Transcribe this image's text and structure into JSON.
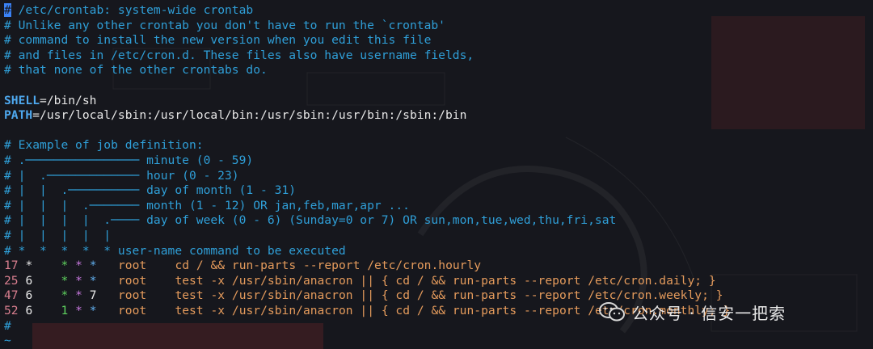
{
  "header_comments": [
    "# /etc/crontab: system-wide crontab",
    "# Unlike any other crontab you don't have to run the `crontab'",
    "# command to install the new version when you edit this file",
    "# and files in /etc/cron.d. These files also have username fields,",
    "# that none of the other crontabs do."
  ],
  "env": {
    "shell_key": "SHELL",
    "shell_value": "=/bin/sh",
    "path_key": "PATH",
    "path_value": "=/usr/local/sbin:/usr/local/bin:/usr/sbin:/usr/bin:/sbin:/bin"
  },
  "job_definition": [
    "# Example of job definition:",
    "# .──────────────── minute (0 - 59)",
    "# |  .───────────── hour (0 - 23)",
    "# |  |  .────────── day of month (1 - 31)",
    "# |  |  |  .─────── month (1 - 12) OR jan,feb,mar,apr ...",
    "# |  |  |  |  .──── day of week (0 - 6) (Sunday=0 or 7) OR sun,mon,tue,wed,thu,fri,sat",
    "# |  |  |  |  |",
    "# *  *  *  *  * user-name command to be executed"
  ],
  "jobs": [
    {
      "min": "17",
      "hour": "*",
      "dom": "*",
      "mon": "*",
      "dow": "*",
      "user": "root",
      "cmd": "cd / && run-parts --report /etc/cron.hourly"
    },
    {
      "min": "25",
      "hour": "6",
      "dom": "*",
      "mon": "*",
      "dow": "*",
      "user": "root",
      "cmd": "test -x /usr/sbin/anacron || { cd / && run-parts --report /etc/cron.daily; }"
    },
    {
      "min": "47",
      "hour": "6",
      "dom": "*",
      "mon": "*",
      "dow": "7",
      "user": "root",
      "cmd": "test -x /usr/sbin/anacron || { cd / && run-parts --report /etc/cron.weekly; }"
    },
    {
      "min": "52",
      "hour": "6",
      "dom": "1",
      "mon": "*",
      "dow": "*",
      "user": "root",
      "cmd": "test -x /usr/sbin/anacron || { cd / && run-parts --report /etc/cron.monthly; }"
    }
  ],
  "trailing": {
    "last_comment": "#",
    "tilde": "~"
  },
  "watermark": {
    "text": "公众号 · 信安一把索",
    "icon": "wechat-icon"
  },
  "colors": {
    "background": "#16171d",
    "comment": "#2f9fd8",
    "keyword": "#4ea8ee",
    "line_number": "#d97f8f",
    "command": "#e59b5c",
    "cursor": "#3b82f6"
  }
}
